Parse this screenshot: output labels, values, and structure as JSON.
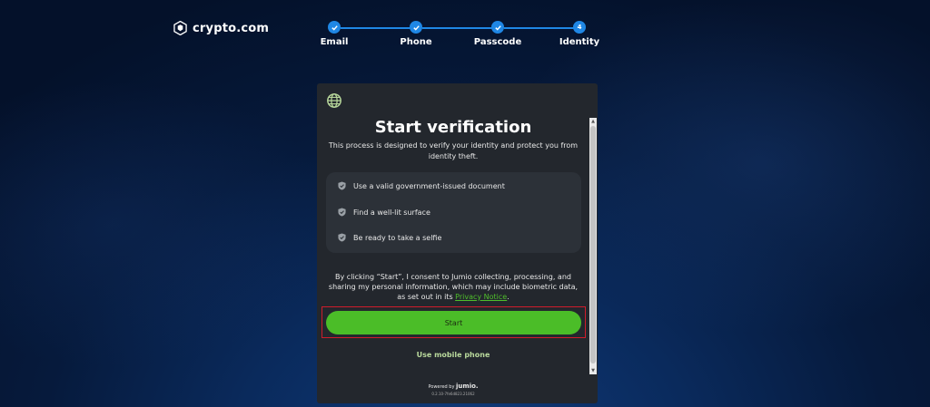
{
  "brand": {
    "name": "crypto.com"
  },
  "stepper": {
    "steps": [
      {
        "label": "Email",
        "state": "done"
      },
      {
        "label": "Phone",
        "state": "done"
      },
      {
        "label": "Passcode",
        "state": "done"
      },
      {
        "label": "Identity",
        "state": "current",
        "number": "4"
      }
    ],
    "accent": "#1f87e5"
  },
  "card": {
    "title": "Start verification",
    "description": "This process is designed to verify your identity and protect you from identity theft.",
    "tips": [
      "Use a valid government-issued document",
      "Find a well-lit surface",
      "Be ready to take a selfie"
    ],
    "consent_text": "By clicking “Start”, I consent to Jumio collecting, processing, and sharing my personal information, which may include biometric data, as set out in its",
    "privacy_link": "Privacy Notice",
    "consent_end": ".",
    "start_label": "Start",
    "mobile_label": "Use mobile phone",
    "powered_by": "Powered by",
    "powered_brand": "jumio.",
    "version": "0.2.10-7fe6d823.21062",
    "button_color": "#4bbd28"
  }
}
